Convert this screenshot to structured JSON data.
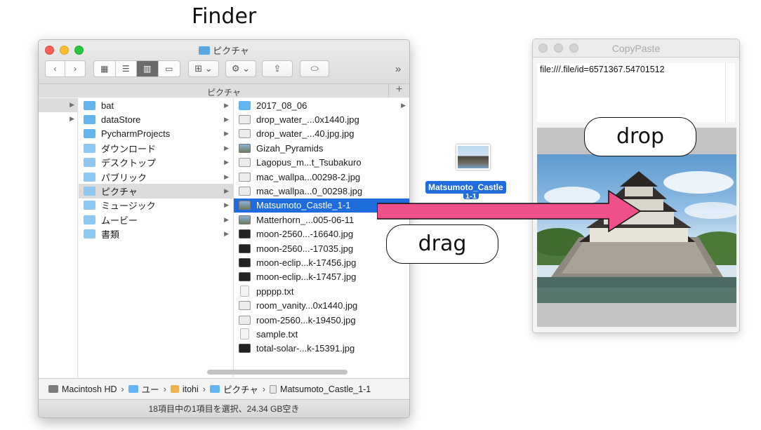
{
  "heading": "Finder",
  "finder": {
    "title": "ピクチャ",
    "toolbar": {
      "back": "‹",
      "forward": "›",
      "view_icons": "▦",
      "view_list": "☰",
      "view_columns": "▥",
      "view_gallery": "▭",
      "arrange": "⊞ ⌄",
      "action": "⚙ ⌄",
      "share": "⇪",
      "tag": "⬭",
      "overflow": "»"
    },
    "path_header": "ピクチャ",
    "plus": "+",
    "col1": [
      {
        "label": "bat",
        "icon": "folder-icon",
        "selected": false
      },
      {
        "label": "dataStore",
        "icon": "folder-icon",
        "selected": false
      },
      {
        "label": "PycharmProjects",
        "icon": "folder-icon",
        "selected": false
      },
      {
        "label": "ダウンロード",
        "icon": "downloads-folder-icon",
        "selected": false
      },
      {
        "label": "デスクトップ",
        "icon": "desktop-folder-icon",
        "selected": false
      },
      {
        "label": "パブリック",
        "icon": "public-folder-icon",
        "selected": false
      },
      {
        "label": "ピクチャ",
        "icon": "pictures-folder-icon",
        "selected": true
      },
      {
        "label": "ミュージック",
        "icon": "music-folder-icon",
        "selected": false
      },
      {
        "label": "ムービー",
        "icon": "movies-folder-icon",
        "selected": false
      },
      {
        "label": "書類",
        "icon": "documents-folder-icon",
        "selected": false
      }
    ],
    "col2": [
      {
        "label": "2017_08_06",
        "kind": "folder",
        "chevron": true
      },
      {
        "label": "drop_water_...0x1440.jpg",
        "kind": "image"
      },
      {
        "label": "drop_water_...40.jpg.jpg",
        "kind": "image"
      },
      {
        "label": "Gizah_Pyramids",
        "kind": "photo"
      },
      {
        "label": "Lagopus_m...t_Tsubakuro",
        "kind": "image"
      },
      {
        "label": "mac_wallpa...00298-2.jpg",
        "kind": "image"
      },
      {
        "label": "mac_wallpa...0_00298.jpg",
        "kind": "image"
      },
      {
        "label": "Matsumoto_Castle_1-1",
        "kind": "photo",
        "selected": true
      },
      {
        "label": "Matterhorn_...005-06-11",
        "kind": "photo"
      },
      {
        "label": "moon-2560...-16640.jpg",
        "kind": "dark"
      },
      {
        "label": "moon-2560...-17035.jpg",
        "kind": "dark"
      },
      {
        "label": "moon-eclip...k-17456.jpg",
        "kind": "dark"
      },
      {
        "label": "moon-eclip...k-17457.jpg",
        "kind": "dark"
      },
      {
        "label": "ppppp.txt",
        "kind": "doc"
      },
      {
        "label": "room_vanity...0x1440.jpg",
        "kind": "image"
      },
      {
        "label": "room-2560...k-19450.jpg",
        "kind": "image"
      },
      {
        "label": "sample.txt",
        "kind": "doc"
      },
      {
        "label": "total-solar-...k-15391.jpg",
        "kind": "dark"
      }
    ],
    "pathbar": {
      "items": [
        "Macintosh HD",
        "ユー",
        "itohi",
        "ピクチャ",
        "Matsumoto_Castle_1-1"
      ],
      "separator": "›"
    },
    "status": "18項目中の1項目を選択、24.34 GB空き"
  },
  "drag": {
    "label": "Matsumoto_Castle",
    "label_line2": "1-1",
    "callout": "drag",
    "arrow_color": "#f0508a"
  },
  "copypaste": {
    "title": "CopyPaste",
    "text": "file:///.file/id=6571367.54701512",
    "callout": "drop"
  },
  "colors": {
    "selection_blue": "#1f6ddc",
    "folder_blue": "#63b4ef",
    "arrow_pink": "#f0508a"
  }
}
